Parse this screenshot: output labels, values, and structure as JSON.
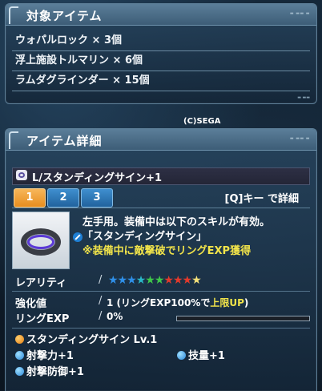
{
  "colors": {
    "accent": "#f2e44a",
    "tab_active": "#e78e1f",
    "tab_inactive": "#21629d"
  },
  "target_panel": {
    "title": "対象アイテム",
    "items": [
      "ウォパルロック × 3個",
      "浮上施設トルマリン × 6個",
      "ラムダグラインダー × 15個"
    ]
  },
  "copyright": "(C)SEGA",
  "detail_panel": {
    "title": "アイテム詳細",
    "item_name": "L/スタンディングサイン+1",
    "tabs": [
      {
        "label": "1",
        "active": true
      },
      {
        "label": "2",
        "active": false
      },
      {
        "label": "3",
        "active": false
      }
    ],
    "hint": "[Q]キー で詳細",
    "description": [
      "左手用。装備中は以下のスキルが有効。",
      "「スタンディングサイン」"
    ],
    "notice": "※装備中に敵撃破でリングEXP獲得",
    "rarity": {
      "label": "レアリティ",
      "stars": 10
    },
    "enhance": {
      "label": "強化値",
      "value_prefix": "1 (リングEXP100%で",
      "value_highlight": "上限UP",
      "value_suffix": ")"
    },
    "exp": {
      "label": "リングEXP",
      "value": "0%",
      "progress": 0
    },
    "abilities": [
      {
        "icon": "ring-skill-icon",
        "label": "スタンディングサイン Lv.1"
      },
      {
        "icon": "boost-icon",
        "label": "射撃力+1"
      },
      {
        "icon": "boost-icon",
        "label": "技量+1"
      },
      {
        "icon": "boost-icon",
        "label": "射撃防御+1"
      }
    ]
  }
}
